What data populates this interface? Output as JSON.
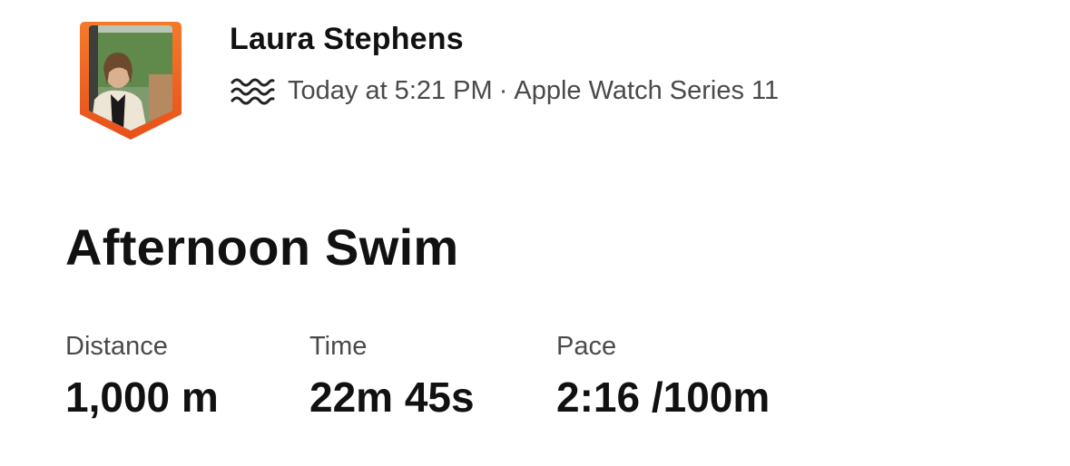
{
  "athlete": {
    "name": "Laura Stephens"
  },
  "activity_meta": {
    "sport_icon": "swim-waves-icon",
    "time": "Today at 5:21 PM",
    "separator": "·",
    "device": "Apple Watch Series 11"
  },
  "activity": {
    "title": "Afternoon Swim"
  },
  "stats": [
    {
      "label": "Distance",
      "value": "1,000 m"
    },
    {
      "label": "Time",
      "value": "22m 45s"
    },
    {
      "label": "Pace",
      "value": "2:16 /100m"
    }
  ],
  "colors": {
    "avatar_border": "#f05a1a",
    "text_primary": "#111111",
    "text_secondary": "#4a4a4a"
  }
}
